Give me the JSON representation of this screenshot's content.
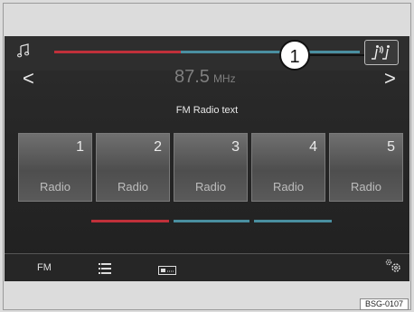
{
  "header": {
    "music_icon": "music-note-icon",
    "seat_icon": "seat-sound-icon",
    "callout_number": "1"
  },
  "nav": {
    "prev_icon": "chevron-left-icon",
    "next_icon": "chevron-right-icon",
    "prev_symbol": "<",
    "next_symbol": ">"
  },
  "tuner": {
    "frequency": "87.5",
    "unit": "MHz",
    "station_text": "FM Radio text"
  },
  "presets": [
    {
      "number": "1",
      "label": "Radio"
    },
    {
      "number": "2",
      "label": "Radio"
    },
    {
      "number": "3",
      "label": "Radio"
    },
    {
      "number": "4",
      "label": "Radio"
    },
    {
      "number": "5",
      "label": "Radio"
    }
  ],
  "bottom_bar": {
    "band": "FM",
    "list_icon": "list-icon",
    "ticker_icon": "traffic-ticker-icon",
    "settings_icon": "settings-gears-icon"
  },
  "figure_code": "BSG-0107",
  "colors": {
    "accent_red": "#c0303a",
    "accent_teal": "#4a8fa0"
  }
}
